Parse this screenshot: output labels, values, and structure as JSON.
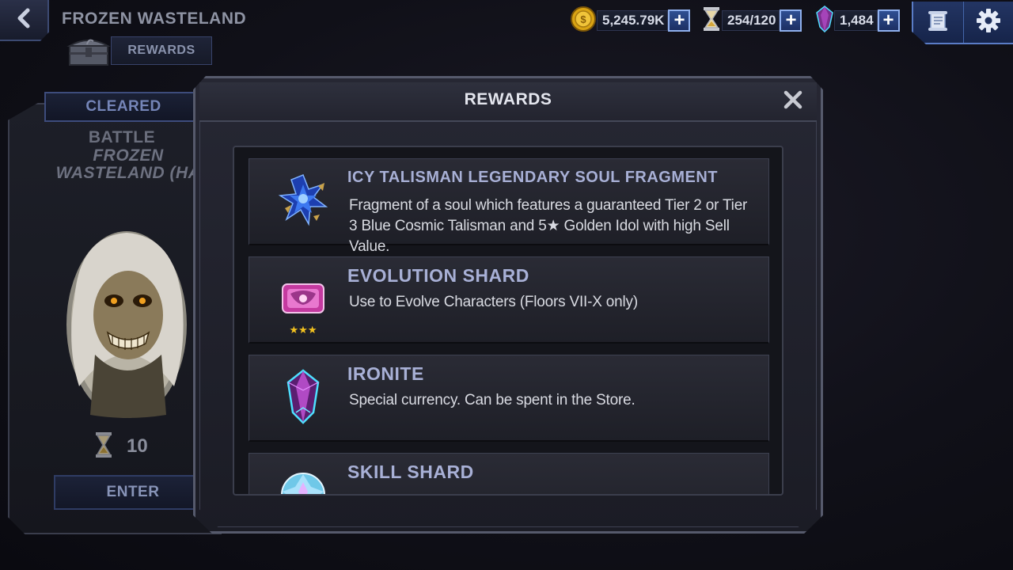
{
  "header": {
    "title": "FROZEN WASTELAND",
    "rewards_tab_label": "REWARDS"
  },
  "currencies": {
    "gold": "5,245.79K",
    "energy": "254/120",
    "ironite": "1,484"
  },
  "battle_panel": {
    "status": "CLEARED",
    "label": "BATTLE",
    "name": "FROZEN\nWASTELAND (HA",
    "energy_cost": "10",
    "enter_label": "ENTER"
  },
  "modal": {
    "title": "REWARDS",
    "items": [
      {
        "name": "ICY TALISMAN LEGENDARY SOUL FRAGMENT",
        "description": "Fragment of a soul which features a guaranteed Tier 2 or Tier 3 Blue Cosmic Talisman and 5★ Golden Idol with high Sell Value.",
        "icon": "soul-fragment-icon"
      },
      {
        "name": "EVOLUTION SHARD",
        "description": "Use to Evolve Characters (Floors VII-X only)",
        "stars": "★★★",
        "icon": "evolution-shard-icon"
      },
      {
        "name": "IRONITE",
        "description": "Special currency. Can be spent in the Store.",
        "icon": "ironite-crystal-icon"
      },
      {
        "name": "SKILL SHARD",
        "description": "",
        "icon": "skill-shard-icon"
      }
    ]
  },
  "colors": {
    "accent_blue": "#5a7cc6",
    "item_title": "#a8b0d6",
    "star_gold": "#f3c21f"
  }
}
